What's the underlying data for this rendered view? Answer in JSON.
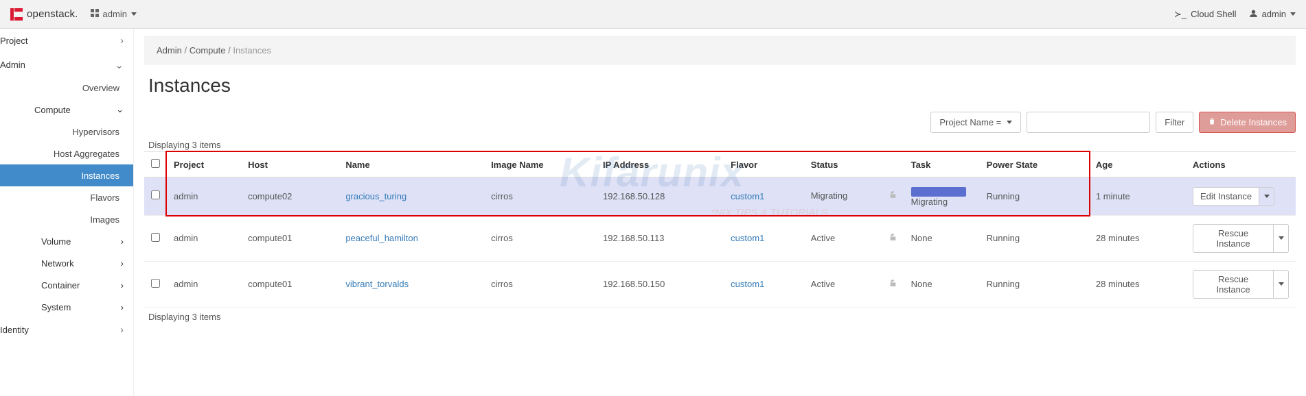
{
  "topbar": {
    "brand": "openstack.",
    "project_label": "admin",
    "cloud_shell": "Cloud Shell",
    "user": "admin"
  },
  "sidebar": {
    "project": "Project",
    "admin": "Admin",
    "overview": "Overview",
    "compute": "Compute",
    "hypervisors": "Hypervisors",
    "host_aggregates": "Host Aggregates",
    "instances": "Instances",
    "flavors": "Flavors",
    "images": "Images",
    "volume": "Volume",
    "network": "Network",
    "container": "Container",
    "system": "System",
    "identity": "Identity"
  },
  "breadcrumb": {
    "a": "Admin",
    "b": "Compute",
    "c": "Instances",
    "sep": "/"
  },
  "page": {
    "title": "Instances"
  },
  "toolbar": {
    "filter_field": "Project Name =",
    "filter_btn": "Filter",
    "delete_btn": "Delete Instances",
    "search_placeholder": ""
  },
  "count_top": "Displaying 3 items",
  "count_bottom": "Displaying 3 items",
  "columns": [
    "Project",
    "Host",
    "Name",
    "Image Name",
    "IP Address",
    "Flavor",
    "Status",
    "Task",
    "Power State",
    "Age",
    "Actions"
  ],
  "rows": [
    {
      "project": "admin",
      "host": "compute02",
      "name": "gracious_turing",
      "image": "cirros",
      "ip": "192.168.50.128",
      "flavor": "custom1",
      "status": "Migrating",
      "task_label": "Migrating",
      "task_bar": true,
      "power": "Running",
      "age": "1 minute",
      "action": "Edit Instance"
    },
    {
      "project": "admin",
      "host": "compute01",
      "name": "peaceful_hamilton",
      "image": "cirros",
      "ip": "192.168.50.113",
      "flavor": "custom1",
      "status": "Active",
      "task_label": "None",
      "task_bar": false,
      "power": "Running",
      "age": "28 minutes",
      "action": "Rescue Instance"
    },
    {
      "project": "admin",
      "host": "compute01",
      "name": "vibrant_torvalds",
      "image": "cirros",
      "ip": "192.168.50.150",
      "flavor": "custom1",
      "status": "Active",
      "task_label": "None",
      "task_bar": false,
      "power": "Running",
      "age": "28 minutes",
      "action": "Rescue Instance"
    }
  ],
  "watermark": {
    "big": "Kifarunix",
    "sub": "*NIX TIPS & TUTORIALS"
  }
}
